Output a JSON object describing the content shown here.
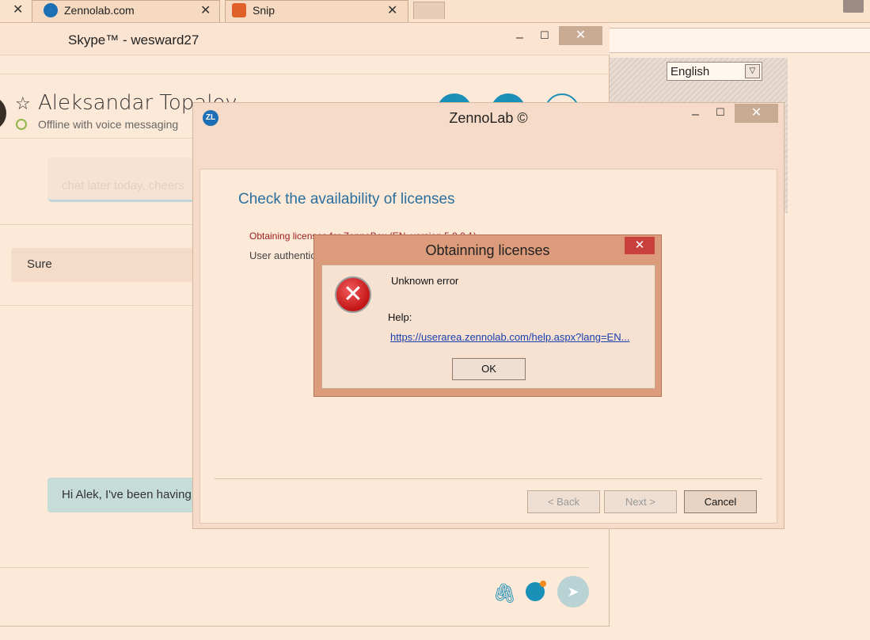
{
  "browser": {
    "tabs": [
      {
        "label": "Zennolab.com"
      },
      {
        "label": "Snip"
      }
    ],
    "close_glyph": "✕"
  },
  "skype": {
    "title": "Skype™ - wesward27",
    "contact_name": "Aleksandar Topalov",
    "status": "Offline with voice messaging",
    "messages": [
      {
        "text": "chat later today, cheers"
      },
      {
        "text": "Sure"
      },
      {
        "text": "Hi Alek, I've been having"
      }
    ]
  },
  "language": {
    "selected": "English"
  },
  "zennolab": {
    "title": "ZennoLab ©",
    "heading": "Check the availability of licenses",
    "line1": "Obtaining licenses for ZennoBox (EN, version 5.9.0.1)",
    "line2": "User authentication",
    "buttons": {
      "back": "< Back",
      "next": "Next >",
      "cancel": "Cancel"
    }
  },
  "dialog": {
    "title": "Obtainning licenses",
    "error": "Unknown error",
    "help_label": "Help:",
    "help_link": "https://userarea.zennolab.com/help.aspx?lang=EN...",
    "ok": "OK"
  },
  "colors": {
    "accent": "#1a8fb8",
    "error_close": "#c9403c",
    "heading": "#2a6f9d"
  }
}
